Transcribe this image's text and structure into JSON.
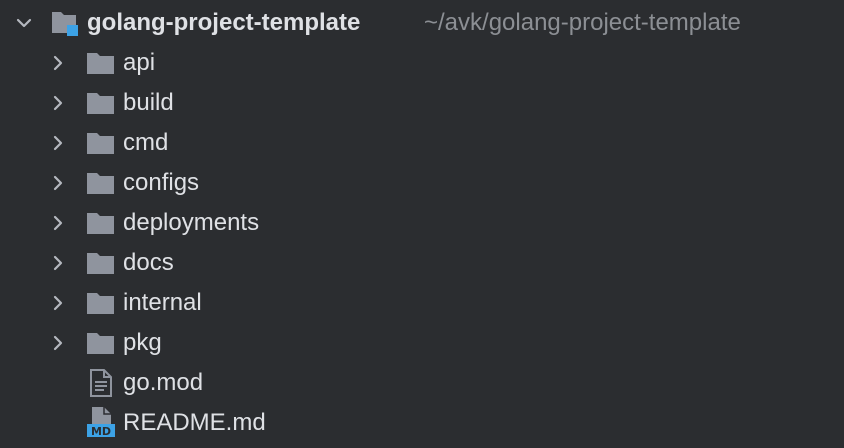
{
  "project": {
    "name": "golang-project-template",
    "path": "~/avk/golang-project-template",
    "expanded": true,
    "icon": "project-folder-icon"
  },
  "folders": [
    {
      "name": "api",
      "icon": "folder-icon"
    },
    {
      "name": "build",
      "icon": "folder-icon"
    },
    {
      "name": "cmd",
      "icon": "folder-icon"
    },
    {
      "name": "configs",
      "icon": "folder-icon"
    },
    {
      "name": "deployments",
      "icon": "folder-icon"
    },
    {
      "name": "docs",
      "icon": "folder-icon"
    },
    {
      "name": "internal",
      "icon": "folder-icon"
    },
    {
      "name": "pkg",
      "icon": "folder-icon"
    }
  ],
  "files": [
    {
      "name": "go.mod",
      "icon": "text-file-icon"
    },
    {
      "name": "README.md",
      "icon": "markdown-file-icon",
      "badge": "MD"
    }
  ],
  "colors": {
    "background": "#2b2d30",
    "text": "#dfe1e5",
    "path_text": "#8c8f94",
    "folder": "#8f949e",
    "accent": "#3ca2e6"
  }
}
